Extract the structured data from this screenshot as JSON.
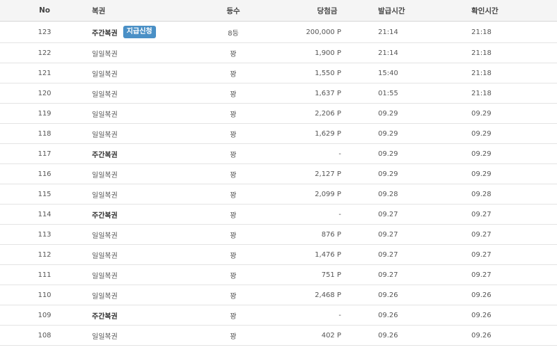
{
  "headers": {
    "no": "No",
    "type": "복권",
    "rank": "등수",
    "prize": "당첨금",
    "issued": "발급시간",
    "checked": "확인시간"
  },
  "claim_label": "지급신청",
  "rows": [
    {
      "no": "123",
      "type": "주간복권",
      "weekly": true,
      "claim": true,
      "rank": "8등",
      "prize": "200,000 P",
      "issued": "21:14",
      "checked": "21:18"
    },
    {
      "no": "122",
      "type": "일일복권",
      "weekly": false,
      "claim": false,
      "rank": "꽝",
      "prize": "1,900 P",
      "issued": "21:14",
      "checked": "21:18"
    },
    {
      "no": "121",
      "type": "일일복권",
      "weekly": false,
      "claim": false,
      "rank": "꽝",
      "prize": "1,550 P",
      "issued": "15:40",
      "checked": "21:18"
    },
    {
      "no": "120",
      "type": "일일복권",
      "weekly": false,
      "claim": false,
      "rank": "꽝",
      "prize": "1,637 P",
      "issued": "01:55",
      "checked": "21:18"
    },
    {
      "no": "119",
      "type": "일일복권",
      "weekly": false,
      "claim": false,
      "rank": "꽝",
      "prize": "2,206 P",
      "issued": "09.29",
      "checked": "09.29"
    },
    {
      "no": "118",
      "type": "일일복권",
      "weekly": false,
      "claim": false,
      "rank": "꽝",
      "prize": "1,629 P",
      "issued": "09.29",
      "checked": "09.29"
    },
    {
      "no": "117",
      "type": "주간복권",
      "weekly": true,
      "claim": false,
      "rank": "꽝",
      "prize": "-",
      "issued": "09.29",
      "checked": "09.29"
    },
    {
      "no": "116",
      "type": "일일복권",
      "weekly": false,
      "claim": false,
      "rank": "꽝",
      "prize": "2,127 P",
      "issued": "09.29",
      "checked": "09.29"
    },
    {
      "no": "115",
      "type": "일일복권",
      "weekly": false,
      "claim": false,
      "rank": "꽝",
      "prize": "2,099 P",
      "issued": "09.28",
      "checked": "09.28"
    },
    {
      "no": "114",
      "type": "주간복권",
      "weekly": true,
      "claim": false,
      "rank": "꽝",
      "prize": "-",
      "issued": "09.27",
      "checked": "09.27"
    },
    {
      "no": "113",
      "type": "일일복권",
      "weekly": false,
      "claim": false,
      "rank": "꽝",
      "prize": "876 P",
      "issued": "09.27",
      "checked": "09.27"
    },
    {
      "no": "112",
      "type": "일일복권",
      "weekly": false,
      "claim": false,
      "rank": "꽝",
      "prize": "1,476 P",
      "issued": "09.27",
      "checked": "09.27"
    },
    {
      "no": "111",
      "type": "일일복권",
      "weekly": false,
      "claim": false,
      "rank": "꽝",
      "prize": "751 P",
      "issued": "09.27",
      "checked": "09.27"
    },
    {
      "no": "110",
      "type": "일일복권",
      "weekly": false,
      "claim": false,
      "rank": "꽝",
      "prize": "2,468 P",
      "issued": "09.26",
      "checked": "09.26"
    },
    {
      "no": "109",
      "type": "주간복권",
      "weekly": true,
      "claim": false,
      "rank": "꽝",
      "prize": "-",
      "issued": "09.26",
      "checked": "09.26"
    },
    {
      "no": "108",
      "type": "일일복권",
      "weekly": false,
      "claim": false,
      "rank": "꽝",
      "prize": "402 P",
      "issued": "09.26",
      "checked": "09.26"
    }
  ]
}
